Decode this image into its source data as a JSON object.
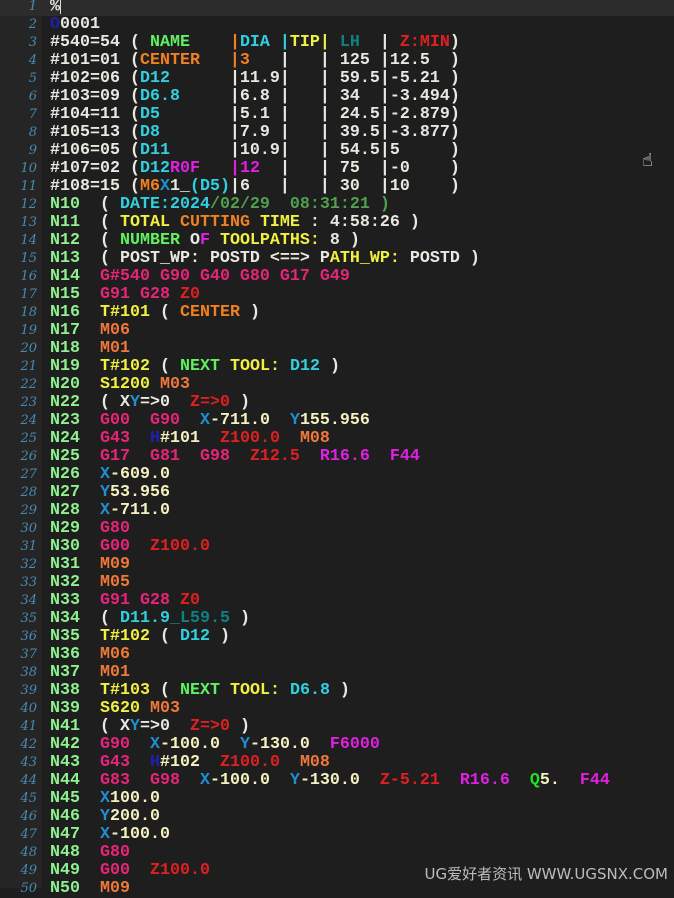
{
  "colors": {
    "w": "#e8e8e0",
    "n": "#8ef08e",
    "g": "#e8247a",
    "m": "#f07838",
    "t": "#f0f040",
    "x": "#1e90d0",
    "z": "#e02020",
    "r": "#e020e0",
    "c": "#30d0e0",
    "o": "#f08020",
    "d": "#50a050",
    "h": "#2020b0",
    "lh": "#108080",
    "q": "#20e020",
    "ng": "#60f060",
    "y": "#f5f0c0"
  },
  "lines": [
    [
      [
        "%",
        "w"
      ]
    ],
    [
      [
        "O",
        "h"
      ],
      [
        "0001",
        "w"
      ]
    ],
    [
      [
        "#540=54 ( ",
        "w"
      ],
      [
        "NAME",
        "ng"
      ],
      [
        "    ",
        "w"
      ],
      [
        "|",
        "o"
      ],
      [
        "DIA ",
        "c"
      ],
      [
        "|",
        "c"
      ],
      [
        "TIP|",
        "t"
      ],
      [
        " ",
        "w"
      ],
      [
        "LH",
        "lh"
      ],
      [
        "  | ",
        "w"
      ],
      [
        "Z:MIN",
        "z"
      ],
      [
        ")",
        "w"
      ]
    ],
    [
      [
        "#101=01 (",
        "w"
      ],
      [
        "CENTER   |3",
        "o"
      ],
      [
        "   |   | 125 |12.5  )",
        "w"
      ]
    ],
    [
      [
        "#102=06 (",
        "w"
      ],
      [
        "D12",
        "c"
      ],
      [
        "      |11.9|   | 59.5|-5.21 )",
        "w"
      ]
    ],
    [
      [
        "#103=09 (",
        "w"
      ],
      [
        "D6.8",
        "c"
      ],
      [
        "     |6.8 |   | 34  |-3.494)",
        "w"
      ]
    ],
    [
      [
        "#104=11 (",
        "w"
      ],
      [
        "D5",
        "c"
      ],
      [
        "       |5.1 |   | 24.5|-2.879)",
        "w"
      ]
    ],
    [
      [
        "#105=13 (",
        "w"
      ],
      [
        "D8",
        "c"
      ],
      [
        "       |7.9 |   | 39.5|-3.877)",
        "w"
      ]
    ],
    [
      [
        "#106=05 (",
        "w"
      ],
      [
        "D11",
        "c"
      ],
      [
        "      |10.9|   | 54.5|5     )",
        "w"
      ]
    ],
    [
      [
        "#107=02 (",
        "w"
      ],
      [
        "D12",
        "c"
      ],
      [
        "R0F",
        "r"
      ],
      [
        "   ",
        "w"
      ],
      [
        "|12",
        "r"
      ],
      [
        "  |   | 75  |-0    )",
        "w"
      ]
    ],
    [
      [
        "#108=15 (",
        "w"
      ],
      [
        "M6",
        "o"
      ],
      [
        "X",
        "x"
      ],
      [
        "1_",
        "w"
      ],
      [
        "(D5)",
        "c"
      ],
      [
        "|6   |   | 30  |10    )",
        "w"
      ]
    ],
    [
      [
        "N10",
        "n"
      ],
      [
        "  ( ",
        "w"
      ],
      [
        "DATE:2024",
        "c"
      ],
      [
        "/02/29  08:31:21 )",
        "d"
      ]
    ],
    [
      [
        "N11",
        "n"
      ],
      [
        "  ( ",
        "w"
      ],
      [
        "TOTAL ",
        "t"
      ],
      [
        "CUTTING ",
        "o"
      ],
      [
        "TIME ",
        "t"
      ],
      [
        ": 4:58:26 )",
        "w"
      ]
    ],
    [
      [
        "N12",
        "n"
      ],
      [
        "  ( ",
        "w"
      ],
      [
        "NUMBER ",
        "ng"
      ],
      [
        "O",
        "w"
      ],
      [
        "F",
        "r"
      ],
      [
        " TOOLPATHS:",
        "t"
      ],
      [
        " 8 )",
        "w"
      ]
    ],
    [
      [
        "N13",
        "n"
      ],
      [
        "  ( POST_WP: POSTD <==> P",
        "w"
      ],
      [
        "ATH_WP:",
        "t"
      ],
      [
        " POSTD )",
        "w"
      ]
    ],
    [
      [
        "N14",
        "n"
      ],
      [
        "  ",
        "w"
      ],
      [
        "G#540 G90 G40 G80 G17 G49",
        "g"
      ]
    ],
    [
      [
        "N15",
        "n"
      ],
      [
        "  ",
        "w"
      ],
      [
        "G91 G28 ",
        "g"
      ],
      [
        "Z0",
        "z"
      ]
    ],
    [
      [
        "N16",
        "n"
      ],
      [
        "  ",
        "w"
      ],
      [
        "T#101",
        "t"
      ],
      [
        " ( ",
        "w"
      ],
      [
        "CENTER",
        "o"
      ],
      [
        " )",
        "w"
      ]
    ],
    [
      [
        "N17",
        "n"
      ],
      [
        "  ",
        "w"
      ],
      [
        "M06",
        "m"
      ]
    ],
    [
      [
        "N18",
        "n"
      ],
      [
        "  ",
        "w"
      ],
      [
        "M01",
        "m"
      ]
    ],
    [
      [
        "N19",
        "n"
      ],
      [
        "  ",
        "w"
      ],
      [
        "T#102",
        "t"
      ],
      [
        " ( ",
        "w"
      ],
      [
        "NEXT ",
        "ng"
      ],
      [
        "TOOL: ",
        "t"
      ],
      [
        "D12",
        "c"
      ],
      [
        " )",
        "w"
      ]
    ],
    [
      [
        "N20",
        "n"
      ],
      [
        "  ",
        "w"
      ],
      [
        "S1200",
        "t"
      ],
      [
        " M03",
        "m"
      ]
    ],
    [
      [
        "N22",
        "n"
      ],
      [
        "  ( X",
        "w"
      ],
      [
        "Y",
        "x"
      ],
      [
        "=>0  ",
        "w"
      ],
      [
        "Z=>0",
        "z"
      ],
      [
        " )",
        "w"
      ]
    ],
    [
      [
        "N23",
        "n"
      ],
      [
        "  ",
        "w"
      ],
      [
        "G00  G90  ",
        "g"
      ],
      [
        "X",
        "x"
      ],
      [
        "-711.0  ",
        "y"
      ],
      [
        "Y",
        "x"
      ],
      [
        "155.956",
        "y"
      ]
    ],
    [
      [
        "N24",
        "n"
      ],
      [
        "  ",
        "w"
      ],
      [
        "G43  ",
        "g"
      ],
      [
        "H",
        "h"
      ],
      [
        "#101  ",
        "y"
      ],
      [
        "Z100.0  ",
        "z"
      ],
      [
        "M08",
        "m"
      ]
    ],
    [
      [
        "N25",
        "n"
      ],
      [
        "  ",
        "w"
      ],
      [
        "G17  G81  G98  ",
        "g"
      ],
      [
        "Z12.5  ",
        "z"
      ],
      [
        "R16.6  F44",
        "r"
      ]
    ],
    [
      [
        "N26",
        "n"
      ],
      [
        "  ",
        "w"
      ],
      [
        "X",
        "x"
      ],
      [
        "-609.0",
        "y"
      ]
    ],
    [
      [
        "N27",
        "n"
      ],
      [
        "  ",
        "w"
      ],
      [
        "Y",
        "x"
      ],
      [
        "53.956",
        "y"
      ]
    ],
    [
      [
        "N28",
        "n"
      ],
      [
        "  ",
        "w"
      ],
      [
        "X",
        "x"
      ],
      [
        "-711.0",
        "y"
      ]
    ],
    [
      [
        "N29",
        "n"
      ],
      [
        "  ",
        "w"
      ],
      [
        "G80",
        "g"
      ]
    ],
    [
      [
        "N30",
        "n"
      ],
      [
        "  ",
        "w"
      ],
      [
        "G00  ",
        "g"
      ],
      [
        "Z100.0",
        "z"
      ]
    ],
    [
      [
        "N31",
        "n"
      ],
      [
        "  ",
        "w"
      ],
      [
        "M09",
        "m"
      ]
    ],
    [
      [
        "N32",
        "n"
      ],
      [
        "  ",
        "w"
      ],
      [
        "M05",
        "m"
      ]
    ],
    [
      [
        "N33",
        "n"
      ],
      [
        "  ",
        "w"
      ],
      [
        "G91 G28 ",
        "g"
      ],
      [
        "Z0",
        "z"
      ]
    ],
    [
      [
        "N34",
        "n"
      ],
      [
        "  ( ",
        "w"
      ],
      [
        "D11.9",
        "c"
      ],
      [
        "_L59.5",
        "lh"
      ],
      [
        " )",
        "w"
      ]
    ],
    [
      [
        "N35",
        "n"
      ],
      [
        "  ",
        "w"
      ],
      [
        "T#102",
        "t"
      ],
      [
        " ( ",
        "w"
      ],
      [
        "D12",
        "c"
      ],
      [
        " )",
        "w"
      ]
    ],
    [
      [
        "N36",
        "n"
      ],
      [
        "  ",
        "w"
      ],
      [
        "M06",
        "m"
      ]
    ],
    [
      [
        "N37",
        "n"
      ],
      [
        "  ",
        "w"
      ],
      [
        "M01",
        "m"
      ]
    ],
    [
      [
        "N38",
        "n"
      ],
      [
        "  ",
        "w"
      ],
      [
        "T#103",
        "t"
      ],
      [
        " ( ",
        "w"
      ],
      [
        "NEXT ",
        "ng"
      ],
      [
        "TOOL: ",
        "t"
      ],
      [
        "D6.8",
        "c"
      ],
      [
        " )",
        "w"
      ]
    ],
    [
      [
        "N39",
        "n"
      ],
      [
        "  ",
        "w"
      ],
      [
        "S620",
        "t"
      ],
      [
        " M03",
        "m"
      ]
    ],
    [
      [
        "N41",
        "n"
      ],
      [
        "  ( X",
        "w"
      ],
      [
        "Y",
        "x"
      ],
      [
        "=>0  ",
        "w"
      ],
      [
        "Z=>0",
        "z"
      ],
      [
        " )",
        "w"
      ]
    ],
    [
      [
        "N42",
        "n"
      ],
      [
        "  ",
        "w"
      ],
      [
        "G90  ",
        "g"
      ],
      [
        "X",
        "x"
      ],
      [
        "-100.0  ",
        "y"
      ],
      [
        "Y",
        "x"
      ],
      [
        "-130.0  ",
        "y"
      ],
      [
        "F6000",
        "r"
      ]
    ],
    [
      [
        "N43",
        "n"
      ],
      [
        "  ",
        "w"
      ],
      [
        "G43  ",
        "g"
      ],
      [
        "H",
        "h"
      ],
      [
        "#102  ",
        "y"
      ],
      [
        "Z100.0  ",
        "z"
      ],
      [
        "M08",
        "m"
      ]
    ],
    [
      [
        "N44",
        "n"
      ],
      [
        "  ",
        "w"
      ],
      [
        "G83  G98  ",
        "g"
      ],
      [
        "X",
        "x"
      ],
      [
        "-100.0  ",
        "y"
      ],
      [
        "Y",
        "x"
      ],
      [
        "-130.0  ",
        "y"
      ],
      [
        "Z-5.21  ",
        "z"
      ],
      [
        "R16.6  ",
        "r"
      ],
      [
        "Q",
        "q"
      ],
      [
        "5.  ",
        "y"
      ],
      [
        "F44",
        "r"
      ]
    ],
    [
      [
        "N45",
        "n"
      ],
      [
        "  ",
        "w"
      ],
      [
        "X",
        "x"
      ],
      [
        "100.0",
        "y"
      ]
    ],
    [
      [
        "N46",
        "n"
      ],
      [
        "  ",
        "w"
      ],
      [
        "Y",
        "x"
      ],
      [
        "200.0",
        "y"
      ]
    ],
    [
      [
        "N47",
        "n"
      ],
      [
        "  ",
        "w"
      ],
      [
        "X",
        "x"
      ],
      [
        "-100.0",
        "y"
      ]
    ],
    [
      [
        "N48",
        "n"
      ],
      [
        "  ",
        "w"
      ],
      [
        "G80",
        "g"
      ]
    ],
    [
      [
        "N49",
        "n"
      ],
      [
        "  ",
        "w"
      ],
      [
        "G00  ",
        "g"
      ],
      [
        "Z100.0",
        "z"
      ]
    ],
    [
      [
        "N50",
        "n"
      ],
      [
        "  ",
        "w"
      ],
      [
        "M09",
        "m"
      ]
    ]
  ],
  "watermark": "UG爱好者资讯 WWW.UGSNX.COM"
}
